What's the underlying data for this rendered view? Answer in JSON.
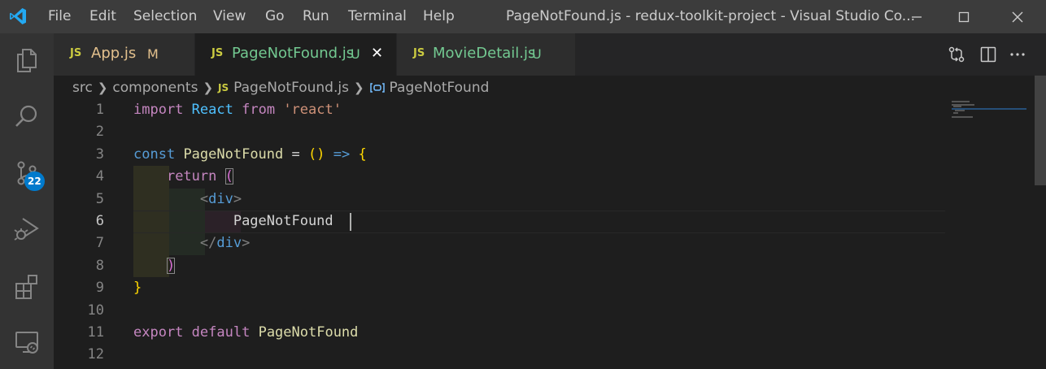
{
  "titlebar": {
    "menu": [
      "File",
      "Edit",
      "Selection",
      "View",
      "Go",
      "Run",
      "Terminal",
      "Help"
    ],
    "window_title": "PageNotFound.js - redux-toolkit-project - Visual Studio Co..."
  },
  "activitybar": {
    "scm_badge": "22",
    "icons": [
      "explorer-icon",
      "search-icon",
      "source-control-icon",
      "run-debug-icon",
      "extensions-icon",
      "remote-explorer-icon"
    ]
  },
  "tabs": [
    {
      "icon": "JS",
      "label": "App.js",
      "status": "M",
      "status_color": "#e2c08d",
      "label_color": "#e2c08d"
    },
    {
      "icon": "JS",
      "label": "PageNotFound.js",
      "status": "U",
      "status_color": "#73c991",
      "label_color": "#73c991",
      "close": "✕"
    },
    {
      "icon": "JS",
      "label": "MovieDetail.js",
      "status": "U",
      "status_color": "#73c991",
      "label_color": "#73c991"
    }
  ],
  "breadcrumb": {
    "items": [
      "src",
      "components",
      "PageNotFound.js",
      "PageNotFound"
    ],
    "js_icon": "JS"
  },
  "editor": {
    "current_line": 6,
    "line_numbers": [
      "1",
      "2",
      "3",
      "4",
      "5",
      "6",
      "7",
      "8",
      "9",
      "10",
      "11",
      "12"
    ],
    "tokens": {
      "l1": [
        "import",
        "React",
        "from",
        "'react'"
      ],
      "l3": [
        "const",
        "PageNotFound",
        "=",
        "()",
        "=>",
        "{"
      ],
      "l4": [
        "return",
        "("
      ],
      "l5": [
        "<",
        "div",
        ">"
      ],
      "l6": [
        "PageNotFound"
      ],
      "l7": [
        "</",
        "div",
        ">"
      ],
      "l8": [
        ")"
      ],
      "l9": [
        "}"
      ],
      "l11": [
        "export",
        "default",
        "PageNotFound"
      ]
    }
  }
}
